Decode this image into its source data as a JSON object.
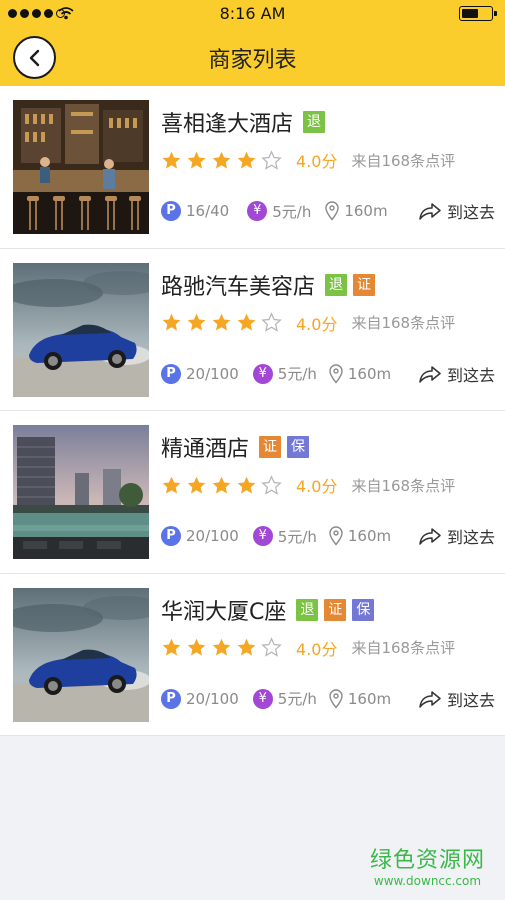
{
  "status_bar": {
    "time": "8:16 AM"
  },
  "nav": {
    "title": "商家列表"
  },
  "merchants": [
    {
      "name": "喜相逢大酒店",
      "badges": [
        "退"
      ],
      "rating": 4,
      "score": "4.0分",
      "review": "来自168条点评",
      "parking": "16/40",
      "price": "5元/h",
      "distance": "160m",
      "go": "到这去"
    },
    {
      "name": "路驰汽车美容店",
      "badges": [
        "退",
        "证"
      ],
      "rating": 4,
      "score": "4.0分",
      "review": "来自168条点评",
      "parking": "20/100",
      "price": "5元/h",
      "distance": "160m",
      "go": "到这去"
    },
    {
      "name": "精通酒店",
      "badges": [
        "证",
        "保"
      ],
      "rating": 4,
      "score": "4.0分",
      "review": "来自168条点评",
      "parking": "20/100",
      "price": "5元/h",
      "distance": "160m",
      "go": "到这去"
    },
    {
      "name": "华润大厦C座",
      "badges": [
        "退",
        "证",
        "保"
      ],
      "rating": 4,
      "score": "4.0分",
      "review": "来自168条点评",
      "parking": "20/100",
      "price": "5元/h",
      "distance": "160m",
      "go": "到这去"
    }
  ],
  "icons": {
    "parking": "P",
    "price": "¥"
  },
  "watermark": {
    "title": "绿色资源网",
    "url": "www.downcc.com"
  },
  "colors": {
    "header": "#fbcd2c",
    "star": "#f5a623",
    "badge_tui": "#7cc345",
    "badge_zheng": "#e58833",
    "badge_bao": "#7377d6"
  }
}
